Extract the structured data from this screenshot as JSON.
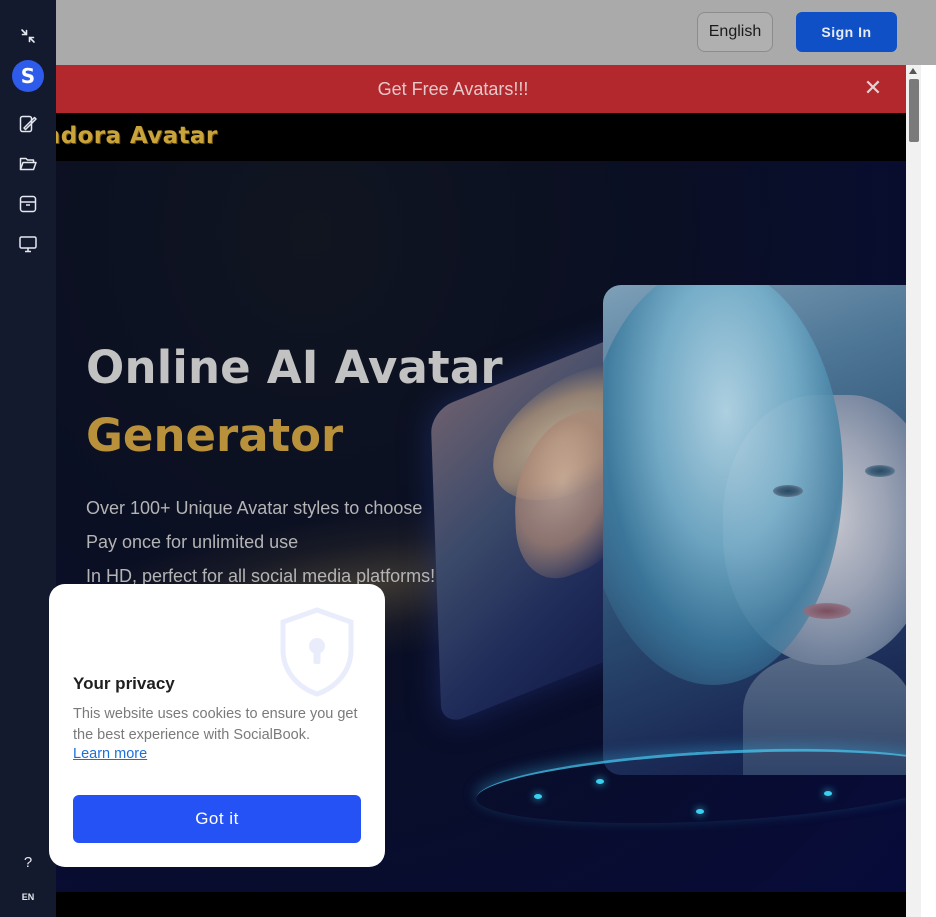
{
  "sidebar": {
    "logo_letter": "S",
    "icons": [
      "collapse-icon",
      "edit-image-icon",
      "folder-icon",
      "archive-icon",
      "monitor-icon"
    ],
    "help_label": "?",
    "language_code": "EN"
  },
  "header": {
    "language_label": "English",
    "signin_label": "Sign In"
  },
  "banner": {
    "text": "Get Free Avatars!!!",
    "close_label": "✕"
  },
  "brand": {
    "name": "andora Avatar"
  },
  "hero": {
    "title_line1": "Online AI Avatar",
    "title_line2": "Generator",
    "features": [
      "Over 100+ Unique Avatar styles to choose",
      "Pay once for unlimited use",
      "In HD, perfect for all social media platforms!"
    ]
  },
  "cookie": {
    "title": "Your privacy",
    "body": "This website uses cookies to ensure you get the best experience with SocialBook.",
    "link": "Learn more",
    "button": "Got it"
  },
  "colors": {
    "sidebar_bg": "#141a2e",
    "banner_bg": "#b3282d",
    "signin_bg": "#0f50c6",
    "accent_gold": "#b8913a",
    "cookie_button": "#2552f5"
  }
}
